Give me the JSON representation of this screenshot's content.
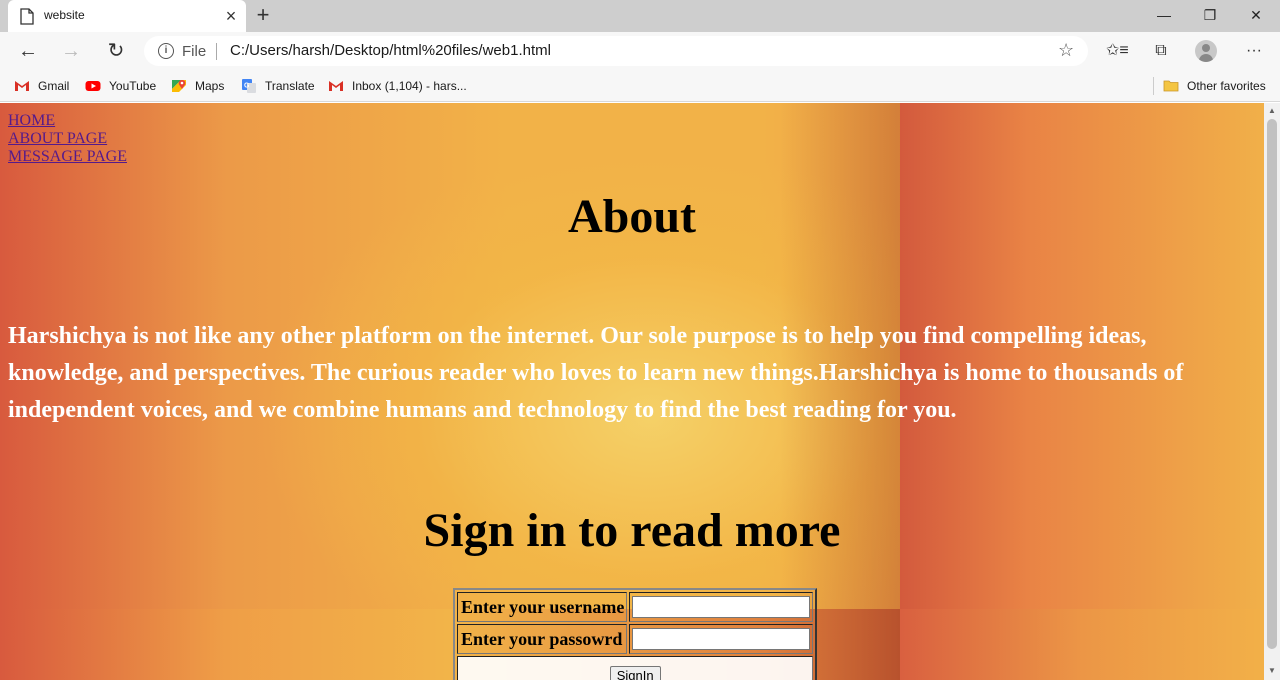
{
  "browser": {
    "tab_title": "website",
    "tab_close": "×",
    "new_tab": "+",
    "window": {
      "minimize": "—",
      "restore": "❐",
      "close": "✕"
    },
    "nav": {
      "back": "←",
      "forward": "→",
      "reload": "↻"
    },
    "address": {
      "scheme": "File",
      "url": "C:/Users/harsh/Desktop/html%20files/web1.html",
      "info_glyph": "i",
      "star": "☆"
    },
    "toolbar_icons": {
      "favorites": "✩≡",
      "collections": "⧉",
      "more": "···"
    },
    "favorites": [
      {
        "label": "Gmail",
        "icon": "gmail-icon",
        "color": "#d93025"
      },
      {
        "label": "YouTube",
        "icon": "youtube-icon",
        "color": "#ff0000"
      },
      {
        "label": "Maps",
        "icon": "maps-icon",
        "color": "#34a853"
      },
      {
        "label": "Translate",
        "icon": "translate-icon",
        "color": "#4285f4"
      },
      {
        "label": "Inbox (1,104) - hars...",
        "icon": "gmail-icon",
        "color": "#d93025"
      }
    ],
    "other_favorites": "Other favorites"
  },
  "page": {
    "nav_links": [
      "HOME",
      "ABOUT PAGE",
      "MESSAGE PAGE"
    ],
    "about_heading": "About",
    "about_text": "Harshichya is not like any other platform on the internet. Our sole purpose is to help you find compelling ideas, knowledge, and perspectives. The curious reader who loves to learn new things.Harshichya is home to thousands of independent voices, and we combine humans and technology to find the best reading for you.",
    "signin_heading": "Sign in to read more",
    "form": {
      "username_label": "Enter your username",
      "username_value": "",
      "password_label": "Enter your passowrd",
      "password_value": "",
      "signin_button": "SignIn"
    },
    "colors": {
      "link": "#551a8b",
      "heading": "#000000",
      "body_text": "#ffffff"
    }
  }
}
